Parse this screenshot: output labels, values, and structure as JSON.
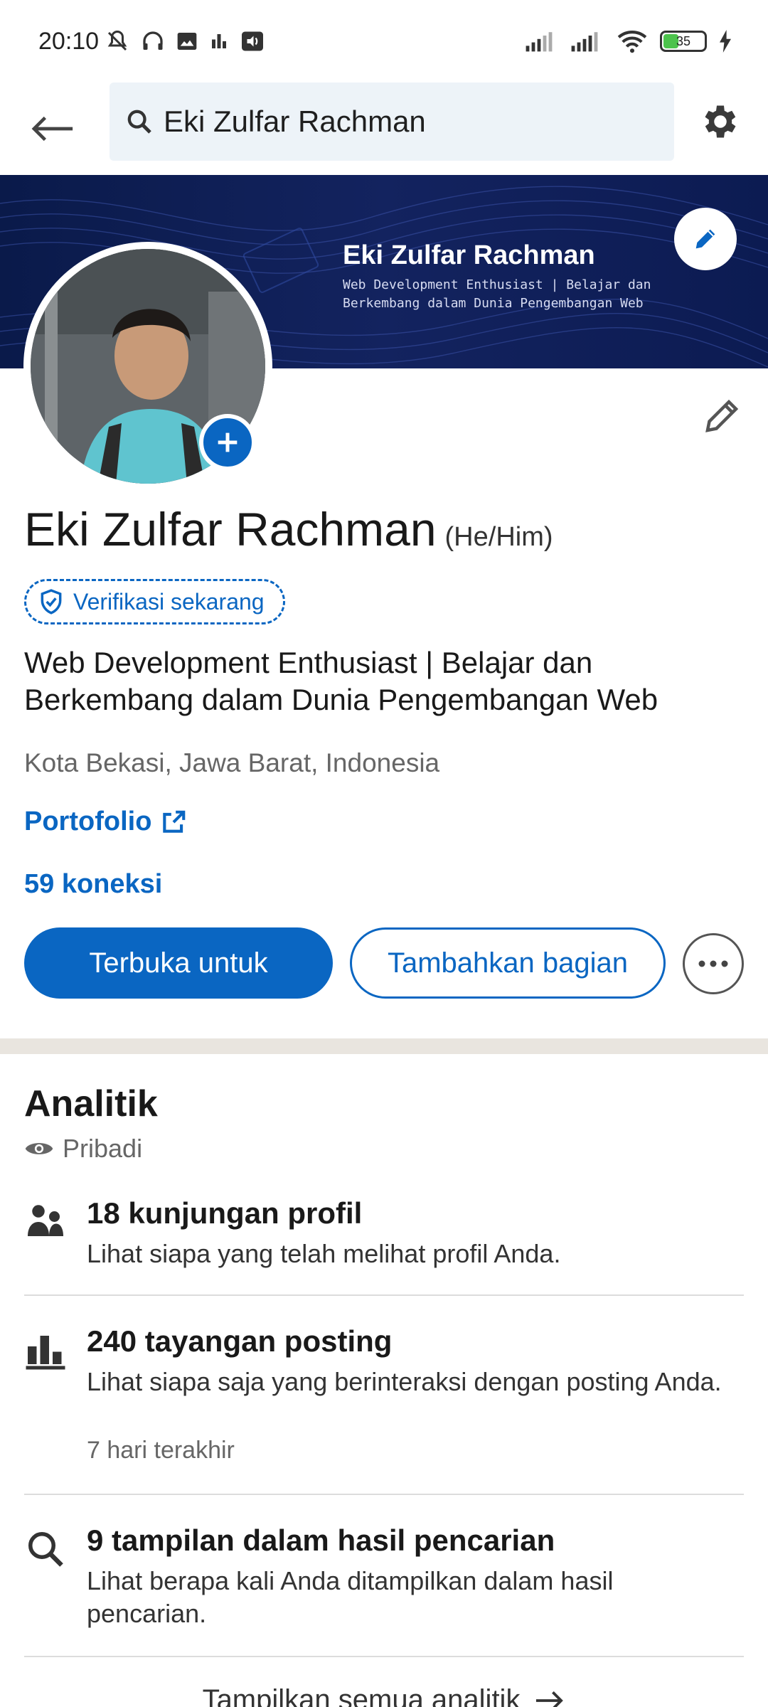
{
  "status_bar": {
    "time": "20:10",
    "battery_level": "35",
    "icons": [
      "mute-bell-icon",
      "headphones-icon",
      "image-icon",
      "equalizer-icon",
      "volume-icon",
      "signal-icon",
      "signal-icon",
      "wifi-icon",
      "battery-icon",
      "charging-icon"
    ]
  },
  "top_bar": {
    "search_value": "Eki Zulfar Rachman"
  },
  "banner": {
    "title": "Eki Zulfar Rachman",
    "subtitle": "Web Development Enthusiast | Belajar dan Berkembang dalam Dunia Pengembangan Web"
  },
  "profile": {
    "name": "Eki Zulfar Rachman",
    "pronouns": "(He/Him)",
    "verify_label": "Verifikasi sekarang",
    "headline": "Web Development Enthusiast | Belajar dan Berkembang dalam Dunia Pengembangan Web",
    "location": "Kota Bekasi, Jawa Barat, Indonesia",
    "portfolio_label": "Portofolio",
    "connections": "59 koneksi"
  },
  "actions": {
    "open_to": "Terbuka untuk",
    "add_section": "Tambahkan bagian"
  },
  "analytics": {
    "title": "Analitik",
    "visibility": "Pribadi",
    "items": [
      {
        "title": "18 kunjungan profil",
        "desc": "Lihat siapa yang telah melihat profil Anda.",
        "icon": "people-icon"
      },
      {
        "title": "240 tayangan posting",
        "desc": "Lihat siapa saja yang berinteraksi dengan posting Anda.",
        "meta": "7 hari terakhir",
        "icon": "bar-chart-icon"
      },
      {
        "title": "9 tampilan dalam hasil pencarian",
        "desc": "Lihat berapa kali Anda ditampilkan dalam hasil pencarian.",
        "icon": "search-icon"
      }
    ],
    "show_all": "Tampilkan semua analitik"
  },
  "colors": {
    "accent": "#0a66c2",
    "banner_bg": "#0f1e55",
    "divider": "#e9e5df"
  }
}
